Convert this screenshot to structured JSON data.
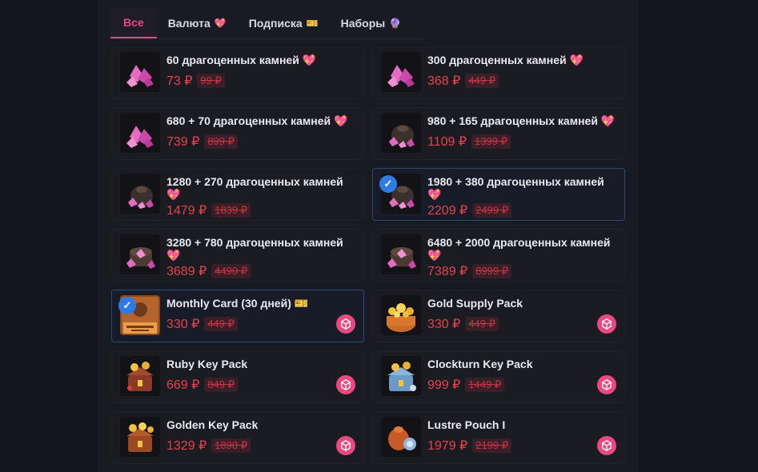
{
  "tabs": [
    {
      "label": "Все",
      "emoji": ""
    },
    {
      "label": "Валюта",
      "emoji": "💖"
    },
    {
      "label": "Подписка",
      "emoji": "🎫"
    },
    {
      "label": "Наборы",
      "emoji": "🔮"
    }
  ],
  "active_tab": "Все",
  "products": [
    {
      "title": "60 драгоценных камней 💖",
      "price": "73 ₽",
      "old_price": "99 ₽",
      "icon": "gem-pile-icon",
      "selected": false,
      "cube": false
    },
    {
      "title": "300 драгоценных камней 💖",
      "price": "368 ₽",
      "old_price": "449 ₽",
      "icon": "gem-pile-icon",
      "selected": false,
      "cube": false
    },
    {
      "title": "680 + 70 драгоценных камней 💖",
      "price": "739 ₽",
      "old_price": "899 ₽",
      "icon": "gem-pile-icon",
      "selected": false,
      "cube": false
    },
    {
      "title": "980 + 165 драгоценных камней 💖",
      "price": "1109 ₽",
      "old_price": "1399 ₽",
      "icon": "gem-bag-icon",
      "selected": false,
      "cube": false
    },
    {
      "title": "1280 + 270 драгоценных камней 💖",
      "price": "1479 ₽",
      "old_price": "1839 ₽",
      "icon": "gem-bag-icon",
      "selected": false,
      "cube": false
    },
    {
      "title": "1980 + 380 драгоценных камней 💖",
      "price": "2209 ₽",
      "old_price": "2499 ₽",
      "icon": "gem-bag-icon",
      "selected": true,
      "cube": false
    },
    {
      "title": "3280 + 780 драгоценных камней 💖",
      "price": "3689 ₽",
      "old_price": "4490 ₽",
      "icon": "gem-chest-icon",
      "selected": false,
      "cube": false
    },
    {
      "title": "6480 + 2000 драгоценных камней 💖",
      "price": "7389 ₽",
      "old_price": "8999 ₽",
      "icon": "gem-chest-icon",
      "selected": false,
      "cube": false
    },
    {
      "title": "Monthly Card (30 дней) 🎫",
      "price": "330 ₽",
      "old_price": "449 ₽",
      "icon": "monthly-card-icon",
      "selected": true,
      "cube": true
    },
    {
      "title": "Gold Supply Pack",
      "price": "330 ₽",
      "old_price": "449 ₽",
      "icon": "gold-basket-icon",
      "selected": false,
      "cube": true
    },
    {
      "title": "Ruby Key Pack",
      "price": "669 ₽",
      "old_price": "849 ₽",
      "icon": "ruby-key-chest-icon",
      "selected": false,
      "cube": true
    },
    {
      "title": "Clockturn Key Pack",
      "price": "999 ₽",
      "old_price": "1449 ₽",
      "icon": "clockturn-key-chest-icon",
      "selected": false,
      "cube": true
    },
    {
      "title": "Golden Key Pack",
      "price": "1329 ₽",
      "old_price": "1890 ₽",
      "icon": "golden-key-chest-icon",
      "selected": false,
      "cube": true
    },
    {
      "title": "Lustre Pouch I",
      "price": "1979 ₽",
      "old_price": "2199 ₽",
      "icon": "lustre-pouch-icon",
      "selected": false,
      "cube": true
    }
  ],
  "colors": {
    "accent": "#e8487f",
    "price": "#e8414e",
    "selected_border": "#2a4a78",
    "check": "#2f7be6"
  }
}
